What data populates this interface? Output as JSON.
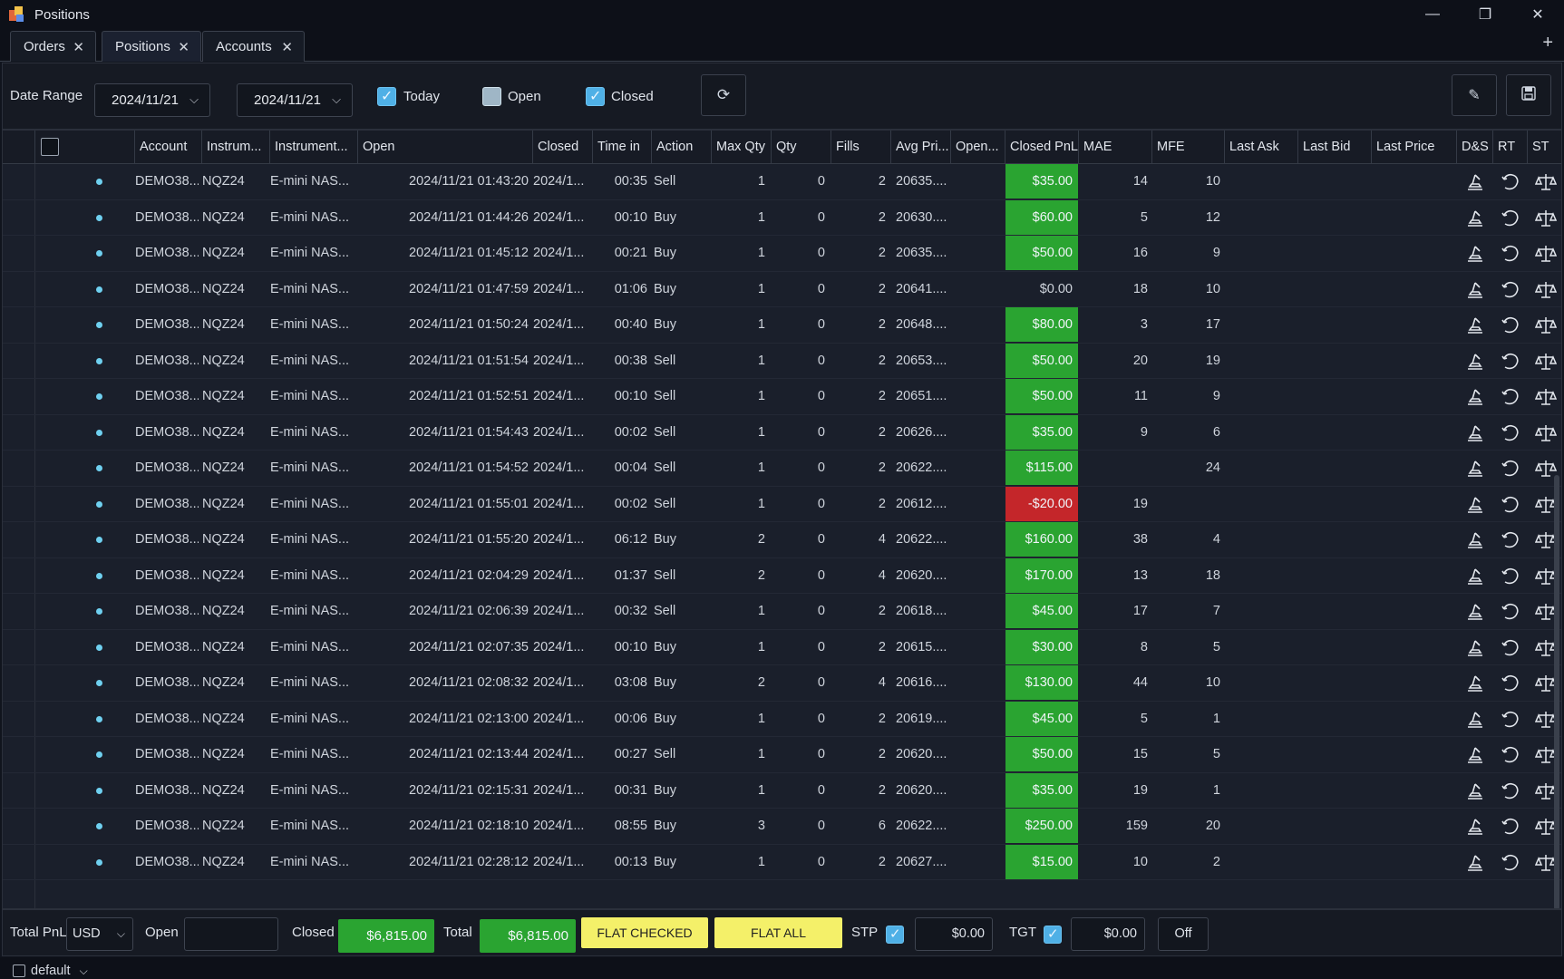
{
  "window": {
    "title": "Positions",
    "controls": [
      "—",
      "❐",
      "✕"
    ]
  },
  "tabs": [
    {
      "label": "Orders",
      "active": false
    },
    {
      "label": "Positions",
      "active": true
    },
    {
      "label": "Accounts",
      "active": false
    }
  ],
  "toolbar": {
    "date_range_label": "Date Range",
    "date_from": "2024/11/21",
    "date_to": "2024/11/21",
    "filters": [
      {
        "label": "Today",
        "checked": true
      },
      {
        "label": "Open",
        "checked": false
      },
      {
        "label": "Closed",
        "checked": true
      }
    ],
    "icons": [
      "refresh-icon",
      "wrench-icon",
      "save-icon"
    ]
  },
  "columns": [
    "Account",
    "Instrum...",
    "Instrument...",
    "Open",
    "Closed",
    "Time in",
    "Action",
    "Max Qty",
    "Qty",
    "Fills",
    "Avg Pri...",
    "Open...",
    "Closed PnL",
    "MAE",
    "MFE",
    "Last Ask",
    "Last Bid",
    "Last Price",
    "D&S",
    "RT",
    "ST"
  ],
  "rows": [
    {
      "account": "DEMO38...",
      "instrument": "NQZ24",
      "instrument_name": "E-mini NAS...",
      "open": "2024/11/21 01:43:20",
      "closed": "2024/1...",
      "time_in": "00:35",
      "action": "Sell",
      "max_qty": "1",
      "qty": "0",
      "fills": "2",
      "avg_price": "20635....",
      "closed_pnl": "$35.00",
      "pnl_sign": "pos",
      "mae": "14",
      "mfe": "10"
    },
    {
      "account": "DEMO38...",
      "instrument": "NQZ24",
      "instrument_name": "E-mini NAS...",
      "open": "2024/11/21 01:44:26",
      "closed": "2024/1...",
      "time_in": "00:10",
      "action": "Buy",
      "max_qty": "1",
      "qty": "0",
      "fills": "2",
      "avg_price": "20630....",
      "closed_pnl": "$60.00",
      "pnl_sign": "pos",
      "mae": "5",
      "mfe": "12"
    },
    {
      "account": "DEMO38...",
      "instrument": "NQZ24",
      "instrument_name": "E-mini NAS...",
      "open": "2024/11/21 01:45:12",
      "closed": "2024/1...",
      "time_in": "00:21",
      "action": "Buy",
      "max_qty": "1",
      "qty": "0",
      "fills": "2",
      "avg_price": "20635....",
      "closed_pnl": "$50.00",
      "pnl_sign": "pos",
      "mae": "16",
      "mfe": "9"
    },
    {
      "account": "DEMO38...",
      "instrument": "NQZ24",
      "instrument_name": "E-mini NAS...",
      "open": "2024/11/21 01:47:59",
      "closed": "2024/1...",
      "time_in": "01:06",
      "action": "Buy",
      "max_qty": "1",
      "qty": "0",
      "fills": "2",
      "avg_price": "20641....",
      "closed_pnl": "$0.00",
      "pnl_sign": "zero",
      "mae": "18",
      "mfe": "10"
    },
    {
      "account": "DEMO38...",
      "instrument": "NQZ24",
      "instrument_name": "E-mini NAS...",
      "open": "2024/11/21 01:50:24",
      "closed": "2024/1...",
      "time_in": "00:40",
      "action": "Buy",
      "max_qty": "1",
      "qty": "0",
      "fills": "2",
      "avg_price": "20648....",
      "closed_pnl": "$80.00",
      "pnl_sign": "pos",
      "mae": "3",
      "mfe": "17"
    },
    {
      "account": "DEMO38...",
      "instrument": "NQZ24",
      "instrument_name": "E-mini NAS...",
      "open": "2024/11/21 01:51:54",
      "closed": "2024/1...",
      "time_in": "00:38",
      "action": "Sell",
      "max_qty": "1",
      "qty": "0",
      "fills": "2",
      "avg_price": "20653....",
      "closed_pnl": "$50.00",
      "pnl_sign": "pos",
      "mae": "20",
      "mfe": "19"
    },
    {
      "account": "DEMO38...",
      "instrument": "NQZ24",
      "instrument_name": "E-mini NAS...",
      "open": "2024/11/21 01:52:51",
      "closed": "2024/1...",
      "time_in": "00:10",
      "action": "Sell",
      "max_qty": "1",
      "qty": "0",
      "fills": "2",
      "avg_price": "20651....",
      "closed_pnl": "$50.00",
      "pnl_sign": "pos",
      "mae": "11",
      "mfe": "9"
    },
    {
      "account": "DEMO38...",
      "instrument": "NQZ24",
      "instrument_name": "E-mini NAS...",
      "open": "2024/11/21 01:54:43",
      "closed": "2024/1...",
      "time_in": "00:02",
      "action": "Sell",
      "max_qty": "1",
      "qty": "0",
      "fills": "2",
      "avg_price": "20626....",
      "closed_pnl": "$35.00",
      "pnl_sign": "pos",
      "mae": "9",
      "mfe": "6"
    },
    {
      "account": "DEMO38...",
      "instrument": "NQZ24",
      "instrument_name": "E-mini NAS...",
      "open": "2024/11/21 01:54:52",
      "closed": "2024/1...",
      "time_in": "00:04",
      "action": "Sell",
      "max_qty": "1",
      "qty": "0",
      "fills": "2",
      "avg_price": "20622....",
      "closed_pnl": "$115.00",
      "pnl_sign": "pos",
      "mae": "",
      "mfe": "24"
    },
    {
      "account": "DEMO38...",
      "instrument": "NQZ24",
      "instrument_name": "E-mini NAS...",
      "open": "2024/11/21 01:55:01",
      "closed": "2024/1...",
      "time_in": "00:02",
      "action": "Sell",
      "max_qty": "1",
      "qty": "0",
      "fills": "2",
      "avg_price": "20612....",
      "closed_pnl": "-$20.00",
      "pnl_sign": "neg",
      "mae": "19",
      "mfe": ""
    },
    {
      "account": "DEMO38...",
      "instrument": "NQZ24",
      "instrument_name": "E-mini NAS...",
      "open": "2024/11/21 01:55:20",
      "closed": "2024/1...",
      "time_in": "06:12",
      "action": "Buy",
      "max_qty": "2",
      "qty": "0",
      "fills": "4",
      "avg_price": "20622....",
      "closed_pnl": "$160.00",
      "pnl_sign": "pos",
      "mae": "38",
      "mfe": "4"
    },
    {
      "account": "DEMO38...",
      "instrument": "NQZ24",
      "instrument_name": "E-mini NAS...",
      "open": "2024/11/21 02:04:29",
      "closed": "2024/1...",
      "time_in": "01:37",
      "action": "Sell",
      "max_qty": "2",
      "qty": "0",
      "fills": "4",
      "avg_price": "20620....",
      "closed_pnl": "$170.00",
      "pnl_sign": "pos",
      "mae": "13",
      "mfe": "18"
    },
    {
      "account": "DEMO38...",
      "instrument": "NQZ24",
      "instrument_name": "E-mini NAS...",
      "open": "2024/11/21 02:06:39",
      "closed": "2024/1...",
      "time_in": "00:32",
      "action": "Sell",
      "max_qty": "1",
      "qty": "0",
      "fills": "2",
      "avg_price": "20618....",
      "closed_pnl": "$45.00",
      "pnl_sign": "pos",
      "mae": "17",
      "mfe": "7"
    },
    {
      "account": "DEMO38...",
      "instrument": "NQZ24",
      "instrument_name": "E-mini NAS...",
      "open": "2024/11/21 02:07:35",
      "closed": "2024/1...",
      "time_in": "00:10",
      "action": "Buy",
      "max_qty": "1",
      "qty": "0",
      "fills": "2",
      "avg_price": "20615....",
      "closed_pnl": "$30.00",
      "pnl_sign": "pos",
      "mae": "8",
      "mfe": "5"
    },
    {
      "account": "DEMO38...",
      "instrument": "NQZ24",
      "instrument_name": "E-mini NAS...",
      "open": "2024/11/21 02:08:32",
      "closed": "2024/1...",
      "time_in": "03:08",
      "action": "Buy",
      "max_qty": "2",
      "qty": "0",
      "fills": "4",
      "avg_price": "20616....",
      "closed_pnl": "$130.00",
      "pnl_sign": "pos",
      "mae": "44",
      "mfe": "10"
    },
    {
      "account": "DEMO38...",
      "instrument": "NQZ24",
      "instrument_name": "E-mini NAS...",
      "open": "2024/11/21 02:13:00",
      "closed": "2024/1...",
      "time_in": "00:06",
      "action": "Buy",
      "max_qty": "1",
      "qty": "0",
      "fills": "2",
      "avg_price": "20619....",
      "closed_pnl": "$45.00",
      "pnl_sign": "pos",
      "mae": "5",
      "mfe": "1"
    },
    {
      "account": "DEMO38...",
      "instrument": "NQZ24",
      "instrument_name": "E-mini NAS...",
      "open": "2024/11/21 02:13:44",
      "closed": "2024/1...",
      "time_in": "00:27",
      "action": "Sell",
      "max_qty": "1",
      "qty": "0",
      "fills": "2",
      "avg_price": "20620....",
      "closed_pnl": "$50.00",
      "pnl_sign": "pos",
      "mae": "15",
      "mfe": "5"
    },
    {
      "account": "DEMO38...",
      "instrument": "NQZ24",
      "instrument_name": "E-mini NAS...",
      "open": "2024/11/21 02:15:31",
      "closed": "2024/1...",
      "time_in": "00:31",
      "action": "Buy",
      "max_qty": "1",
      "qty": "0",
      "fills": "2",
      "avg_price": "20620....",
      "closed_pnl": "$35.00",
      "pnl_sign": "pos",
      "mae": "19",
      "mfe": "1"
    },
    {
      "account": "DEMO38...",
      "instrument": "NQZ24",
      "instrument_name": "E-mini NAS...",
      "open": "2024/11/21 02:18:10",
      "closed": "2024/1...",
      "time_in": "08:55",
      "action": "Buy",
      "max_qty": "3",
      "qty": "0",
      "fills": "6",
      "avg_price": "20622....",
      "closed_pnl": "$250.00",
      "pnl_sign": "pos",
      "mae": "159",
      "mfe": "20"
    },
    {
      "account": "DEMO38...",
      "instrument": "NQZ24",
      "instrument_name": "E-mini NAS...",
      "open": "2024/11/21 02:28:12",
      "closed": "2024/1...",
      "time_in": "00:13",
      "action": "Buy",
      "max_qty": "1",
      "qty": "0",
      "fills": "2",
      "avg_price": "20627....",
      "closed_pnl": "$15.00",
      "pnl_sign": "pos",
      "mae": "10",
      "mfe": "2"
    }
  ],
  "footer": {
    "total_pnl_label": "Total PnL",
    "currency": "USD",
    "open_label": "Open",
    "open_value": "",
    "closed_label": "Closed",
    "closed_value": "$6,815.00",
    "total_label": "Total",
    "total_value": "$6,815.00",
    "flat_checked": "FLAT CHECKED",
    "flat_all": "FLAT ALL",
    "stp_label": "STP",
    "stp_value": "$0.00",
    "tgt_label": "TGT",
    "tgt_value": "$0.00",
    "off_label": "Off"
  },
  "status": {
    "workspace": "default"
  },
  "colors": {
    "positive": "#2aa431",
    "negative": "#c4262a",
    "accent": "#4fb0e6",
    "flat_button": "#f4f069"
  }
}
